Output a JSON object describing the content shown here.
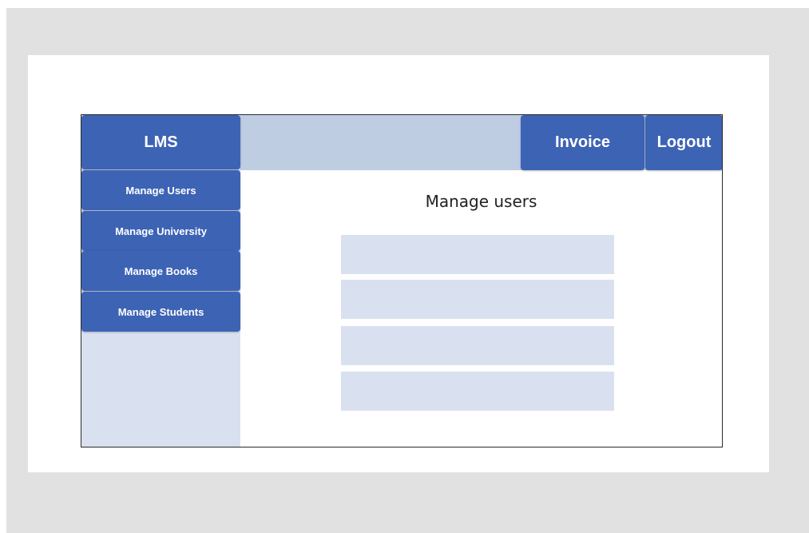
{
  "app": {
    "brand": "LMS"
  },
  "header": {
    "invoice_label": "Invoice",
    "logout_label": "Logout"
  },
  "sidebar": {
    "items": [
      {
        "label": "Manage Users"
      },
      {
        "label": "Manage University"
      },
      {
        "label": "Manage Books"
      },
      {
        "label": "Manage Students"
      }
    ]
  },
  "main": {
    "title": "Manage users",
    "fields": [
      {
        "value": ""
      },
      {
        "value": ""
      },
      {
        "value": ""
      },
      {
        "value": ""
      }
    ]
  },
  "colors": {
    "button": "#3d63b5",
    "header_bar": "#bfcde3",
    "sidebar": "#d9e1f0",
    "field": "#d9e1f0",
    "outer_background": "#e1e1e1"
  }
}
